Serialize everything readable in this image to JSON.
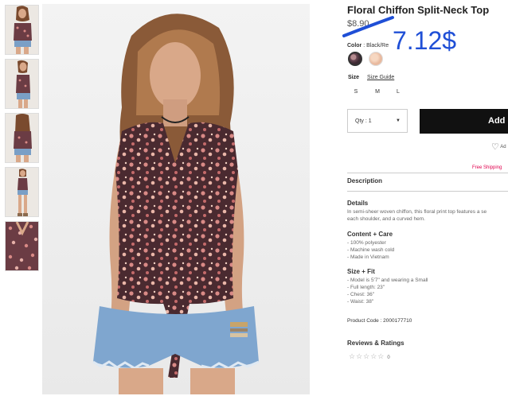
{
  "product": {
    "title": "Floral Chiffon Split-Neck Top",
    "old_price": "$8.90",
    "new_price_annotation": "7.12$",
    "color_label": "Color",
    "color_value": ": Black/Re",
    "size_label": "Size",
    "size_guide": "Size Guide",
    "sizes": [
      "S",
      "M",
      "L"
    ],
    "qty": "Qty : 1",
    "add_button": "Add",
    "wishlist": "Ad",
    "free_shipping": "Free Shipping",
    "description_heading": "Description",
    "details_heading": "Details",
    "details_text": [
      "In semi-sheer woven chiffon, this floral print top features a se",
      "each shoulder, and a curved hem."
    ],
    "content_heading": "Content + Care",
    "content_items": [
      "- 100% polyester",
      "- Machine wash cold",
      "- Made in Vietnam"
    ],
    "fit_heading": "Size + Fit",
    "fit_items": [
      "- Model is 5'7\" and wearing a Small",
      "- Full length: 23\"",
      "- Chest: 36\"",
      "- Waist: 38\""
    ],
    "product_code": "Product Code : 2000177710",
    "reviews_heading": "Reviews & Ratings",
    "stars": "☆☆☆☆☆",
    "review_count": "0"
  },
  "colors": {
    "annotation_blue": "#1f4fd6",
    "free_shipping": "#e0004d",
    "button_bg": "#111111"
  },
  "icons": {
    "caret": "caret-down-icon",
    "heart": "heart-icon",
    "star": "star-icon"
  }
}
